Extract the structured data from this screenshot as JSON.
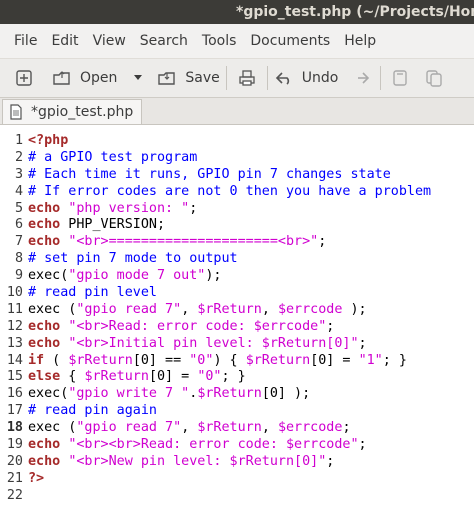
{
  "window": {
    "title": "*gpio_test.php (~/Projects/Home"
  },
  "menu": [
    "File",
    "Edit",
    "View",
    "Search",
    "Tools",
    "Documents",
    "Help"
  ],
  "toolbar": {
    "open_label": "Open",
    "save_label": "Save",
    "undo_label": "Undo"
  },
  "tab": {
    "label": "*gpio_test.php"
  },
  "editor": {
    "current_line": 18,
    "lines": [
      [
        [
          "kw",
          "<?php"
        ]
      ],
      [
        [
          "cm",
          "# a GPIO test program"
        ]
      ],
      [
        [
          "cm",
          "# Each time it runs, GPIO pin 7 changes state"
        ]
      ],
      [
        [
          "cm",
          "# If error codes are not 0 then you have a problem"
        ]
      ],
      [
        [
          "kw",
          "echo"
        ],
        [
          "fn",
          " "
        ],
        [
          "str",
          "\"php version: \""
        ],
        [
          "fn",
          ";"
        ]
      ],
      [
        [
          "kw",
          "echo"
        ],
        [
          "fn",
          " PHP_VERSION;"
        ]
      ],
      [
        [
          "kw",
          "echo"
        ],
        [
          "fn",
          " "
        ],
        [
          "str",
          "\"<br>=====================<br>\""
        ],
        [
          "fn",
          ";"
        ]
      ],
      [
        [
          "cm",
          "# set pin 7 mode to output"
        ]
      ],
      [
        [
          "fn",
          "exec("
        ],
        [
          "str",
          "\"gpio mode 7 out\""
        ],
        [
          "fn",
          ");"
        ]
      ],
      [
        [
          "cm",
          "# read pin level"
        ]
      ],
      [
        [
          "fn",
          "exec ("
        ],
        [
          "str",
          "\"gpio read 7\""
        ],
        [
          "fn",
          ", "
        ],
        [
          "str",
          "$rReturn"
        ],
        [
          "fn",
          ", "
        ],
        [
          "str",
          "$errcode"
        ],
        [
          "fn",
          " );"
        ]
      ],
      [
        [
          "kw",
          "echo"
        ],
        [
          "fn",
          " "
        ],
        [
          "str",
          "\"<br>Read: error code: $errcode\""
        ],
        [
          "fn",
          ";"
        ]
      ],
      [
        [
          "kw",
          "echo"
        ],
        [
          "fn",
          " "
        ],
        [
          "str",
          "\"<br>Initial pin level: $rReturn[0]\""
        ],
        [
          "fn",
          ";"
        ]
      ],
      [
        [
          "kw",
          "if"
        ],
        [
          "fn",
          " ( "
        ],
        [
          "str",
          "$rReturn"
        ],
        [
          "fn",
          "[0] == "
        ],
        [
          "str",
          "\"0\""
        ],
        [
          "fn",
          ") { "
        ],
        [
          "str",
          "$rReturn"
        ],
        [
          "fn",
          "[0] = "
        ],
        [
          "str",
          "\"1\""
        ],
        [
          "fn",
          "; }"
        ]
      ],
      [
        [
          "kw",
          "else"
        ],
        [
          "fn",
          " { "
        ],
        [
          "str",
          "$rReturn"
        ],
        [
          "fn",
          "[0] = "
        ],
        [
          "str",
          "\"0\""
        ],
        [
          "fn",
          "; }"
        ]
      ],
      [
        [
          "fn",
          "exec("
        ],
        [
          "str",
          "\"gpio write 7 \""
        ],
        [
          "fn",
          "."
        ],
        [
          "str",
          "$rReturn"
        ],
        [
          "fn",
          "[0] );"
        ]
      ],
      [
        [
          "cm",
          "# read pin again"
        ]
      ],
      [
        [
          "fn",
          "exec ("
        ],
        [
          "str",
          "\"gpio read 7\""
        ],
        [
          "fn",
          ", "
        ],
        [
          "str",
          "$rReturn"
        ],
        [
          "fn",
          ", "
        ],
        [
          "str",
          "$errcode"
        ],
        [
          "fn",
          ";"
        ]
      ],
      [
        [
          "kw",
          "echo"
        ],
        [
          "fn",
          " "
        ],
        [
          "str",
          "\"<br><br>Read: error code: $errcode\""
        ],
        [
          "fn",
          ";"
        ]
      ],
      [
        [
          "kw",
          "echo"
        ],
        [
          "fn",
          " "
        ],
        [
          "str",
          "\"<br>New pin level: $rReturn[0]\""
        ],
        [
          "fn",
          ";"
        ]
      ],
      [
        [
          "kw",
          "?>"
        ]
      ],
      []
    ]
  }
}
